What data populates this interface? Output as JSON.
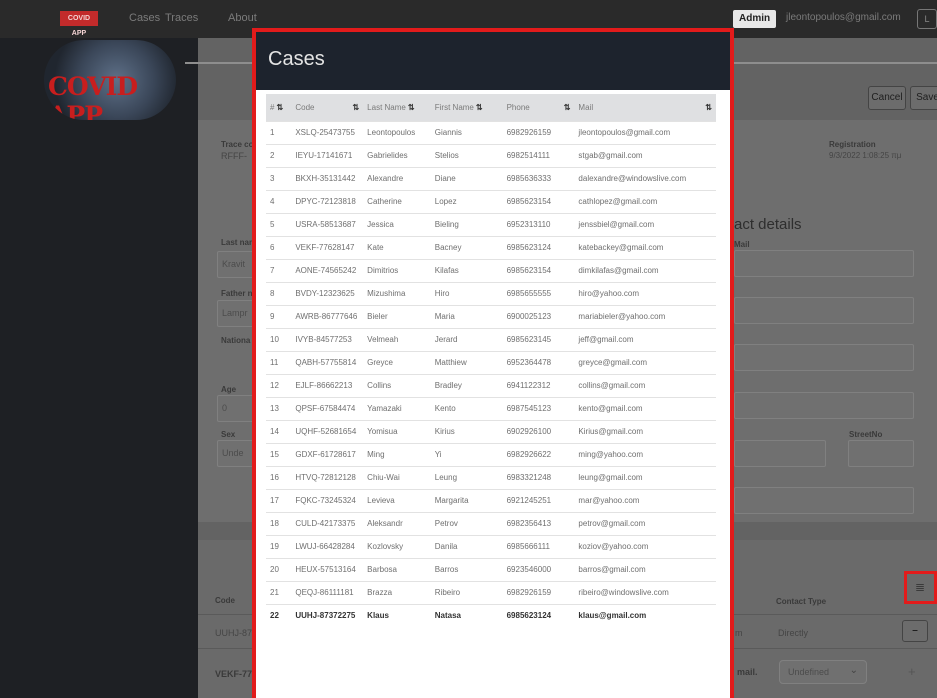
{
  "navbar": {
    "brand": "COVID APP",
    "links": [
      "Cases",
      "Traces",
      "About"
    ],
    "admin_label": "Admin",
    "user_email": "jleontopoulos@gmail.com",
    "user_button_label": "L"
  },
  "logo_text": "COVID APP",
  "background_page": {
    "cancel_label": "Cancel",
    "save_label": "Save",
    "trace_code_label": "Trace co",
    "trace_code_value": "RFFF-",
    "registration_label": "Registration",
    "registration_value": "9/3/2022 1:08:25 πμ",
    "contact_details_heading": "act details",
    "last_name_label": "Last nam",
    "last_name_value": "Kravit",
    "mail_label": "Mail",
    "father_label": "Father n",
    "father_value": "Lampr",
    "nationality_label": "Nationa",
    "age_label": "Age",
    "age_value": "0",
    "sex_label": "Sex",
    "sex_value": "Unde",
    "street_no_label": "StreetNo",
    "code_label": "Code",
    "contact_type_label": "Contact Type",
    "row1_code": "UUHJ-873",
    "row1_relation": "m",
    "row1_contact_type": "Directly",
    "row1_button": "–",
    "row2_code": "VEKF-776",
    "row2_mail": "mail.",
    "row2_select": "Undefined",
    "row2_button": "+",
    "table_icon": "≣"
  },
  "modal": {
    "title": "Cases",
    "columns": [
      "#",
      "Code",
      "Last Name",
      "First Name",
      "Phone",
      "Mail"
    ],
    "sort_icon": "⇅",
    "rows": [
      [
        "1",
        "XSLQ-25473755",
        "Leontopoulos",
        "Giannis",
        "6982926159",
        "jleontopoulos@gmail.com"
      ],
      [
        "2",
        "IEYU-17141671",
        "Gabrielides",
        "Stelios",
        "6982514111",
        "stgab@gmail.com"
      ],
      [
        "3",
        "BKXH-35131442",
        "Alexandre",
        "Diane",
        "6985636333",
        "dalexandre@windowslive.com"
      ],
      [
        "4",
        "DPYC-72123818",
        "Catherine",
        "Lopez",
        "6985623154",
        "cathlopez@gmail.com"
      ],
      [
        "5",
        "USRA-58513687",
        "Jessica",
        "Bieling",
        "6952313110",
        "jenssbiel@gmail.com"
      ],
      [
        "6",
        "VEKF-77628147",
        "Kate",
        "Bacney",
        "6985623124",
        "katebackey@gmail.com"
      ],
      [
        "7",
        "AONE-74565242",
        "Dimitrios",
        "Kilafas",
        "6985623154",
        "dimkilafas@gmail.com"
      ],
      [
        "8",
        "BVDY-12323625",
        "Mizushima",
        "Hiro",
        "6985655555",
        "hiro@yahoo.com"
      ],
      [
        "9",
        "AWRB-86777646",
        "Bieler",
        "Maria",
        "6900025123",
        "mariabieler@yahoo.com"
      ],
      [
        "10",
        "IVYB-84577253",
        "Velmeah",
        "Jerard",
        "6985623145",
        "jeff@gmail.com"
      ],
      [
        "11",
        "QABH-57755814",
        "Greyce",
        "Matthiew",
        "6952364478",
        "greyce@gmail.com"
      ],
      [
        "12",
        "EJLF-86662213",
        "Collins",
        "Bradley",
        "6941122312",
        "collins@gmail.com"
      ],
      [
        "13",
        "QPSF-67584474",
        "Yamazaki",
        "Kento",
        "6987545123",
        "kento@gmail.com"
      ],
      [
        "14",
        "UQHF-52681654",
        "Yomisua",
        "Kirius",
        "6902926100",
        "Kirius@gmail.com"
      ],
      [
        "15",
        "GDXF-61728617",
        "Ming",
        "Yi",
        "6982926622",
        "ming@yahoo.com"
      ],
      [
        "16",
        "HTVQ-72812128",
        "Chiu-Wai",
        "Leung",
        "6983321248",
        "leung@gmail.com"
      ],
      [
        "17",
        "FQKC-73245324",
        "Levieva",
        "Margarita",
        "6921245251",
        "mar@yahoo.com"
      ],
      [
        "18",
        "CULD-42173375",
        "Aleksandr",
        "Petrov",
        "6982356413",
        "petrov@gmail.com"
      ],
      [
        "19",
        "LWUJ-66428284",
        "Kozlovsky",
        "Danila",
        "6985666111",
        "koziov@yahoo.com"
      ],
      [
        "20",
        "HEUX-57513164",
        "Barbosa",
        "Barros",
        "6923546000",
        "barros@gmail.com"
      ],
      [
        "21",
        "QEQJ-86111181",
        "Brazza",
        "Ribeiro",
        "6982926159",
        "ribeiro@windowslive.com"
      ],
      [
        "22",
        "UUHJ-87372275",
        "Klaus",
        "Natasa",
        "6985623124",
        "klaus@gmail.com"
      ]
    ]
  },
  "colors": {
    "highlight": "#e21b1b",
    "navbar": "#2a2a2a",
    "modal_header": "#1d232d",
    "brand_red": "#c81e1e"
  }
}
